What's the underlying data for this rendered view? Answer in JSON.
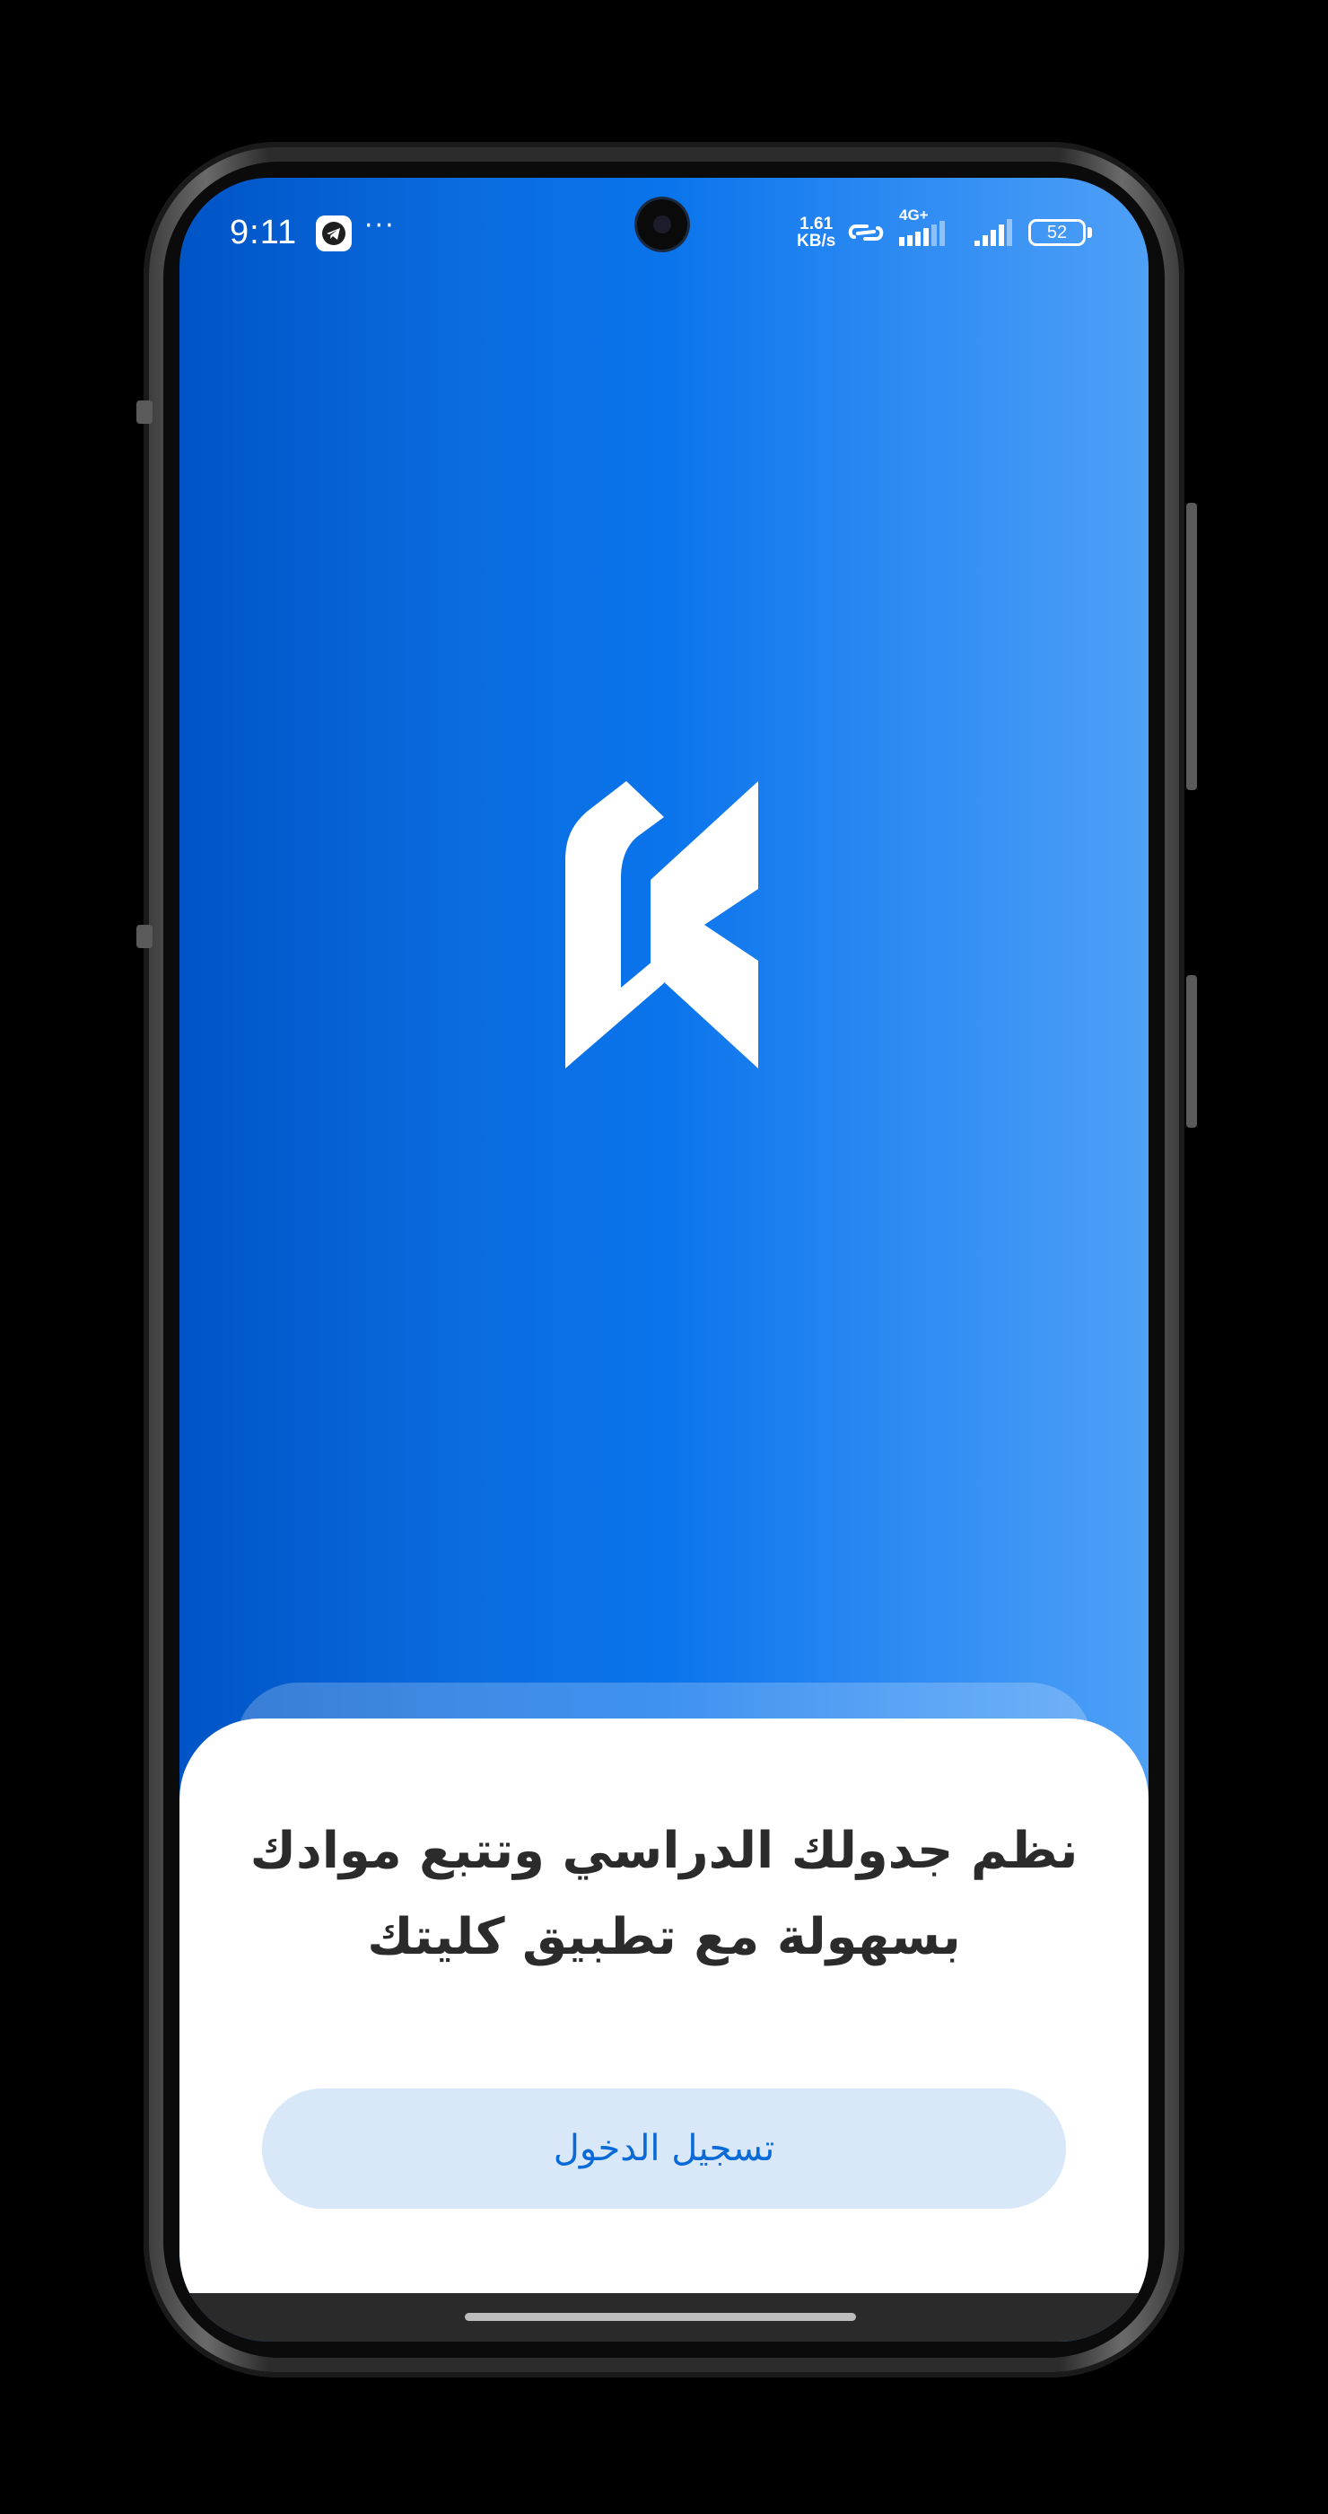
{
  "status_bar": {
    "time": "9:11",
    "more_indicator": "···",
    "net_speed_value": "1.61",
    "net_speed_unit": "KB/s",
    "network_type": "4G+",
    "battery_level": "52",
    "icons": [
      "telegram-icon",
      "hotspot-icon",
      "signal-icon",
      "battery-icon"
    ]
  },
  "splash": {
    "logo": "app-logo-k",
    "headline_line1": "نظم جدولك الدراسي وتتبع موادك",
    "headline_line2": "بسهولة مع تطبيق كليتك",
    "login_label": "تسجيل الدخول"
  },
  "colors": {
    "gradient_left": "#0054c6",
    "gradient_mid": "#0a74ec",
    "gradient_right": "#4ea0f6",
    "button_bg": "#d8e8f8",
    "button_text": "#0a6ad8",
    "headline_text": "#2b2b2b"
  }
}
